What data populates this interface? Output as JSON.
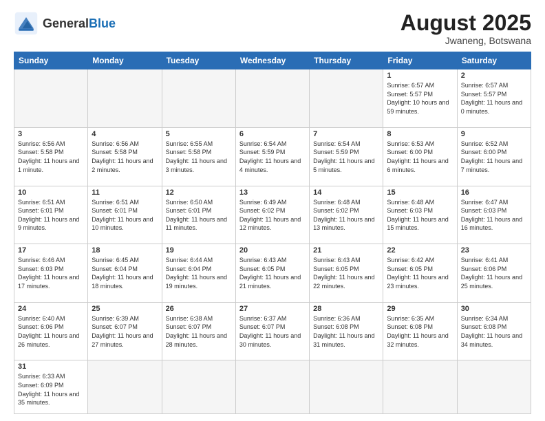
{
  "header": {
    "logo_general": "General",
    "logo_blue": "Blue",
    "month_title": "August 2025",
    "location": "Jwaneng, Botswana"
  },
  "days_of_week": [
    "Sunday",
    "Monday",
    "Tuesday",
    "Wednesday",
    "Thursday",
    "Friday",
    "Saturday"
  ],
  "weeks": [
    [
      {
        "day": "",
        "sunrise": "",
        "sunset": "",
        "daylight": "",
        "empty": true
      },
      {
        "day": "",
        "sunrise": "",
        "sunset": "",
        "daylight": "",
        "empty": true
      },
      {
        "day": "",
        "sunrise": "",
        "sunset": "",
        "daylight": "",
        "empty": true
      },
      {
        "day": "",
        "sunrise": "",
        "sunset": "",
        "daylight": "",
        "empty": true
      },
      {
        "day": "",
        "sunrise": "",
        "sunset": "",
        "daylight": "",
        "empty": true
      },
      {
        "day": "1",
        "sunrise": "Sunrise: 6:57 AM",
        "sunset": "Sunset: 5:57 PM",
        "daylight": "Daylight: 10 hours and 59 minutes.",
        "empty": false
      },
      {
        "day": "2",
        "sunrise": "Sunrise: 6:57 AM",
        "sunset": "Sunset: 5:57 PM",
        "daylight": "Daylight: 11 hours and 0 minutes.",
        "empty": false
      }
    ],
    [
      {
        "day": "3",
        "sunrise": "Sunrise: 6:56 AM",
        "sunset": "Sunset: 5:58 PM",
        "daylight": "Daylight: 11 hours and 1 minute.",
        "empty": false
      },
      {
        "day": "4",
        "sunrise": "Sunrise: 6:56 AM",
        "sunset": "Sunset: 5:58 PM",
        "daylight": "Daylight: 11 hours and 2 minutes.",
        "empty": false
      },
      {
        "day": "5",
        "sunrise": "Sunrise: 6:55 AM",
        "sunset": "Sunset: 5:58 PM",
        "daylight": "Daylight: 11 hours and 3 minutes.",
        "empty": false
      },
      {
        "day": "6",
        "sunrise": "Sunrise: 6:54 AM",
        "sunset": "Sunset: 5:59 PM",
        "daylight": "Daylight: 11 hours and 4 minutes.",
        "empty": false
      },
      {
        "day": "7",
        "sunrise": "Sunrise: 6:54 AM",
        "sunset": "Sunset: 5:59 PM",
        "daylight": "Daylight: 11 hours and 5 minutes.",
        "empty": false
      },
      {
        "day": "8",
        "sunrise": "Sunrise: 6:53 AM",
        "sunset": "Sunset: 6:00 PM",
        "daylight": "Daylight: 11 hours and 6 minutes.",
        "empty": false
      },
      {
        "day": "9",
        "sunrise": "Sunrise: 6:52 AM",
        "sunset": "Sunset: 6:00 PM",
        "daylight": "Daylight: 11 hours and 7 minutes.",
        "empty": false
      }
    ],
    [
      {
        "day": "10",
        "sunrise": "Sunrise: 6:51 AM",
        "sunset": "Sunset: 6:01 PM",
        "daylight": "Daylight: 11 hours and 9 minutes.",
        "empty": false
      },
      {
        "day": "11",
        "sunrise": "Sunrise: 6:51 AM",
        "sunset": "Sunset: 6:01 PM",
        "daylight": "Daylight: 11 hours and 10 minutes.",
        "empty": false
      },
      {
        "day": "12",
        "sunrise": "Sunrise: 6:50 AM",
        "sunset": "Sunset: 6:01 PM",
        "daylight": "Daylight: 11 hours and 11 minutes.",
        "empty": false
      },
      {
        "day": "13",
        "sunrise": "Sunrise: 6:49 AM",
        "sunset": "Sunset: 6:02 PM",
        "daylight": "Daylight: 11 hours and 12 minutes.",
        "empty": false
      },
      {
        "day": "14",
        "sunrise": "Sunrise: 6:48 AM",
        "sunset": "Sunset: 6:02 PM",
        "daylight": "Daylight: 11 hours and 13 minutes.",
        "empty": false
      },
      {
        "day": "15",
        "sunrise": "Sunrise: 6:48 AM",
        "sunset": "Sunset: 6:03 PM",
        "daylight": "Daylight: 11 hours and 15 minutes.",
        "empty": false
      },
      {
        "day": "16",
        "sunrise": "Sunrise: 6:47 AM",
        "sunset": "Sunset: 6:03 PM",
        "daylight": "Daylight: 11 hours and 16 minutes.",
        "empty": false
      }
    ],
    [
      {
        "day": "17",
        "sunrise": "Sunrise: 6:46 AM",
        "sunset": "Sunset: 6:03 PM",
        "daylight": "Daylight: 11 hours and 17 minutes.",
        "empty": false
      },
      {
        "day": "18",
        "sunrise": "Sunrise: 6:45 AM",
        "sunset": "Sunset: 6:04 PM",
        "daylight": "Daylight: 11 hours and 18 minutes.",
        "empty": false
      },
      {
        "day": "19",
        "sunrise": "Sunrise: 6:44 AM",
        "sunset": "Sunset: 6:04 PM",
        "daylight": "Daylight: 11 hours and 19 minutes.",
        "empty": false
      },
      {
        "day": "20",
        "sunrise": "Sunrise: 6:43 AM",
        "sunset": "Sunset: 6:05 PM",
        "daylight": "Daylight: 11 hours and 21 minutes.",
        "empty": false
      },
      {
        "day": "21",
        "sunrise": "Sunrise: 6:43 AM",
        "sunset": "Sunset: 6:05 PM",
        "daylight": "Daylight: 11 hours and 22 minutes.",
        "empty": false
      },
      {
        "day": "22",
        "sunrise": "Sunrise: 6:42 AM",
        "sunset": "Sunset: 6:05 PM",
        "daylight": "Daylight: 11 hours and 23 minutes.",
        "empty": false
      },
      {
        "day": "23",
        "sunrise": "Sunrise: 6:41 AM",
        "sunset": "Sunset: 6:06 PM",
        "daylight": "Daylight: 11 hours and 25 minutes.",
        "empty": false
      }
    ],
    [
      {
        "day": "24",
        "sunrise": "Sunrise: 6:40 AM",
        "sunset": "Sunset: 6:06 PM",
        "daylight": "Daylight: 11 hours and 26 minutes.",
        "empty": false
      },
      {
        "day": "25",
        "sunrise": "Sunrise: 6:39 AM",
        "sunset": "Sunset: 6:07 PM",
        "daylight": "Daylight: 11 hours and 27 minutes.",
        "empty": false
      },
      {
        "day": "26",
        "sunrise": "Sunrise: 6:38 AM",
        "sunset": "Sunset: 6:07 PM",
        "daylight": "Daylight: 11 hours and 28 minutes.",
        "empty": false
      },
      {
        "day": "27",
        "sunrise": "Sunrise: 6:37 AM",
        "sunset": "Sunset: 6:07 PM",
        "daylight": "Daylight: 11 hours and 30 minutes.",
        "empty": false
      },
      {
        "day": "28",
        "sunrise": "Sunrise: 6:36 AM",
        "sunset": "Sunset: 6:08 PM",
        "daylight": "Daylight: 11 hours and 31 minutes.",
        "empty": false
      },
      {
        "day": "29",
        "sunrise": "Sunrise: 6:35 AM",
        "sunset": "Sunset: 6:08 PM",
        "daylight": "Daylight: 11 hours and 32 minutes.",
        "empty": false
      },
      {
        "day": "30",
        "sunrise": "Sunrise: 6:34 AM",
        "sunset": "Sunset: 6:08 PM",
        "daylight": "Daylight: 11 hours and 34 minutes.",
        "empty": false
      }
    ],
    [
      {
        "day": "31",
        "sunrise": "Sunrise: 6:33 AM",
        "sunset": "Sunset: 6:09 PM",
        "daylight": "Daylight: 11 hours and 35 minutes.",
        "empty": false
      },
      {
        "day": "",
        "sunrise": "",
        "sunset": "",
        "daylight": "",
        "empty": true
      },
      {
        "day": "",
        "sunrise": "",
        "sunset": "",
        "daylight": "",
        "empty": true
      },
      {
        "day": "",
        "sunrise": "",
        "sunset": "",
        "daylight": "",
        "empty": true
      },
      {
        "day": "",
        "sunrise": "",
        "sunset": "",
        "daylight": "",
        "empty": true
      },
      {
        "day": "",
        "sunrise": "",
        "sunset": "",
        "daylight": "",
        "empty": true
      },
      {
        "day": "",
        "sunrise": "",
        "sunset": "",
        "daylight": "",
        "empty": true
      }
    ]
  ]
}
